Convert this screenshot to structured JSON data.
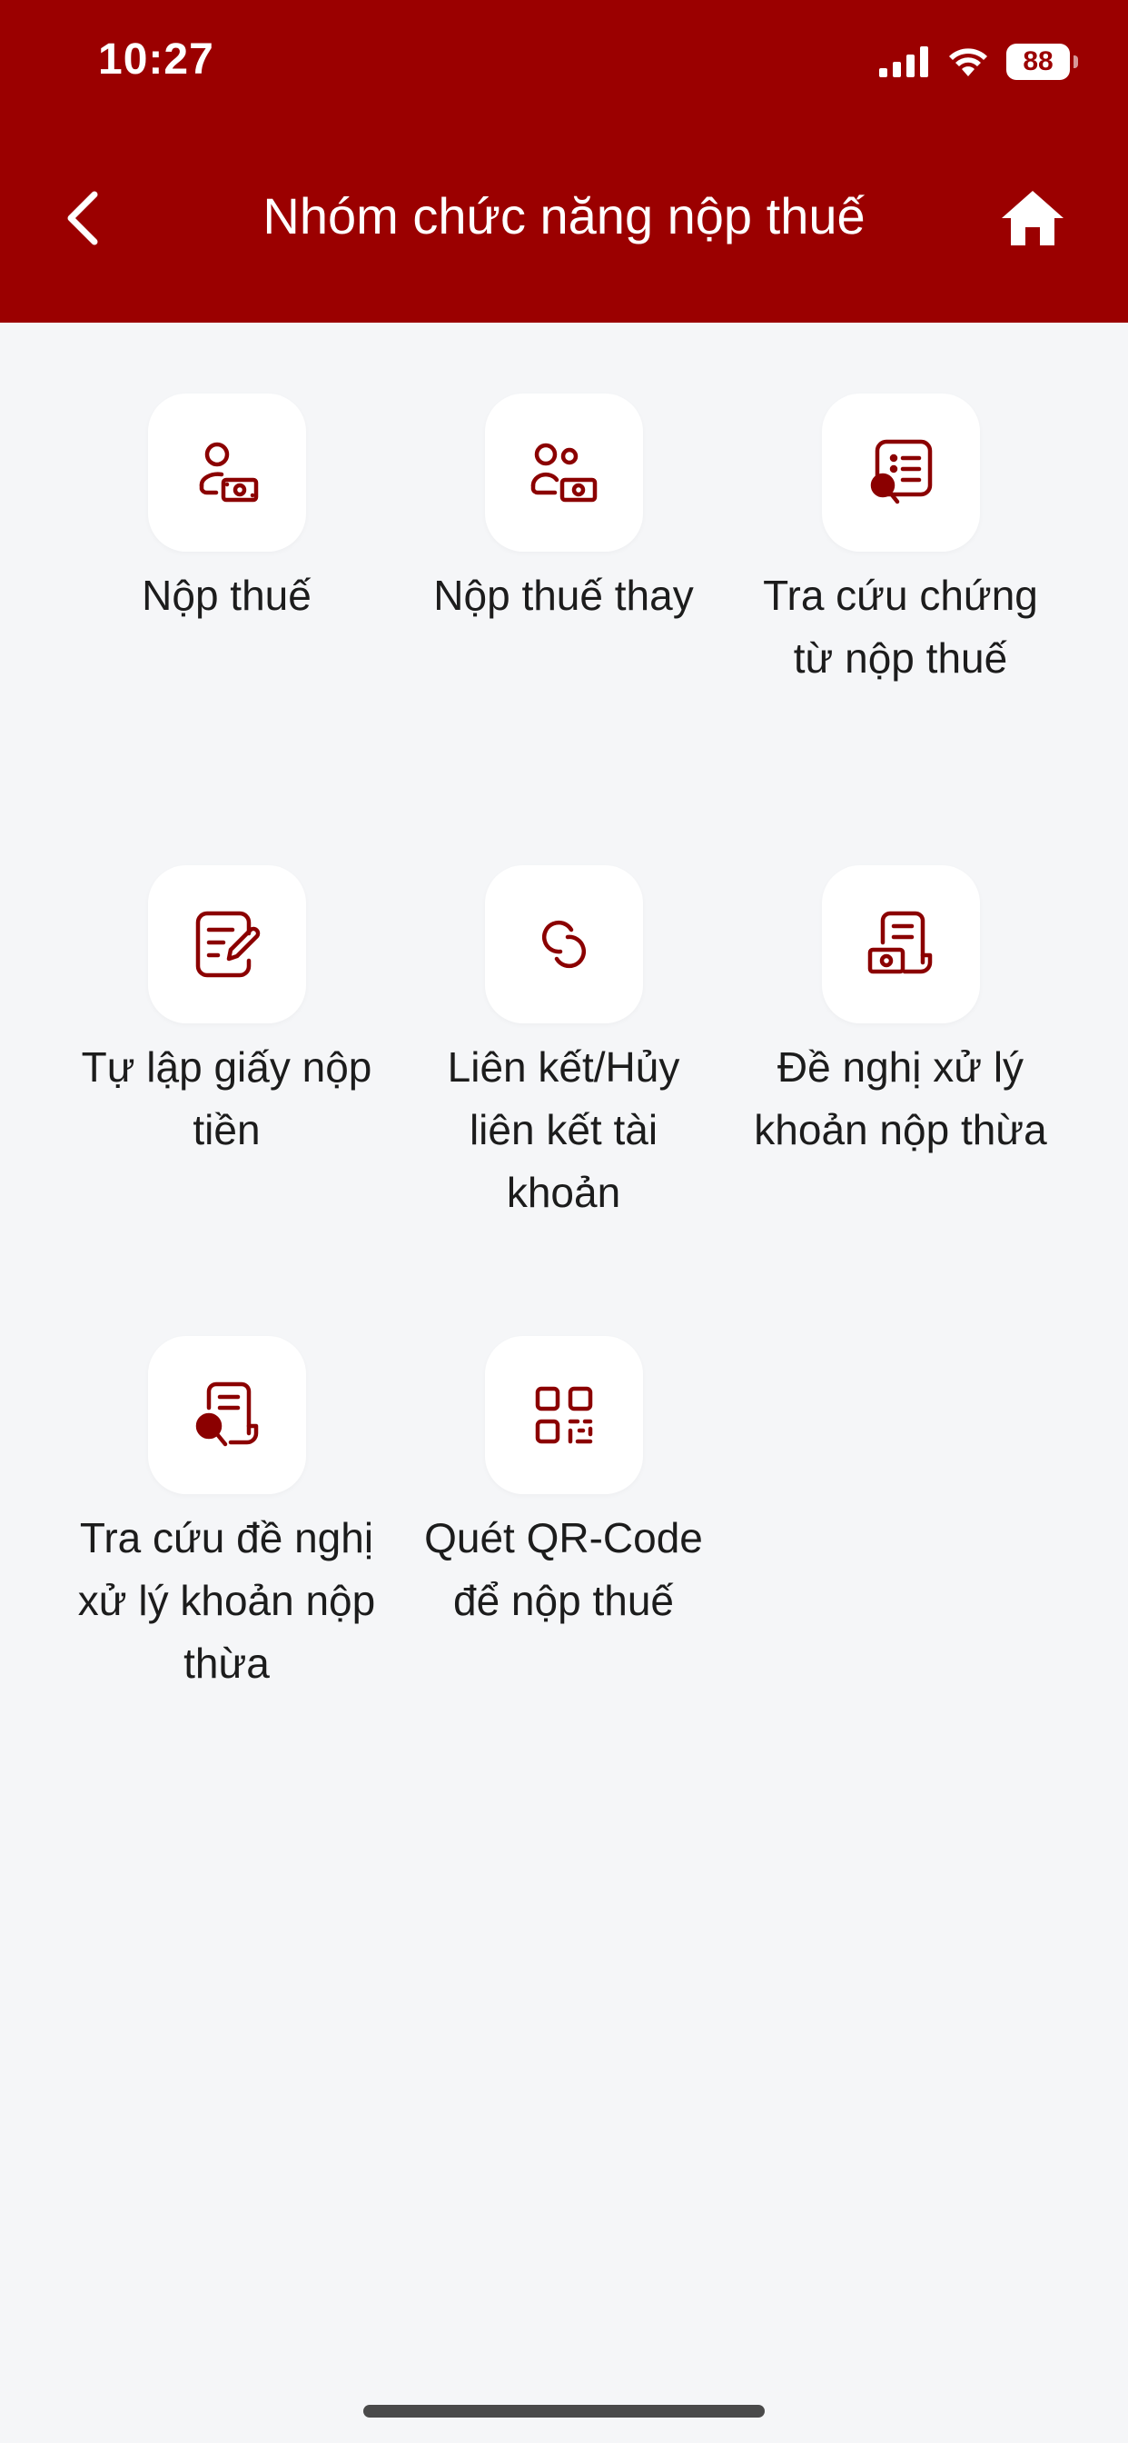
{
  "status_bar": {
    "time": "10:27",
    "battery": "88",
    "icons": [
      "signal-icon",
      "wifi-icon",
      "battery-icon"
    ]
  },
  "header": {
    "title": "Nhóm chức năng nộp thuế",
    "back_icon": "chevron-left-icon",
    "home_icon": "home-icon"
  },
  "theme": {
    "primary": "#9b0000",
    "background": "#f5f6f8",
    "tile_background": "#ffffff",
    "icon_color": "#8b0000"
  },
  "items": [
    {
      "label": "Nộp thuế",
      "icon": "person-money-icon"
    },
    {
      "label": "Nộp thuế thay",
      "icon": "group-money-icon"
    },
    {
      "label": "Tra cứu chứng từ nộp thuế",
      "icon": "document-search-icon"
    },
    {
      "label": "Tự lập giấy nộp tiền",
      "icon": "edit-document-icon"
    },
    {
      "label": "Liên kết/Hủy liên kết tài khoản",
      "icon": "link-icon"
    },
    {
      "label": "Đề nghị xử lý khoản nộp thừa",
      "icon": "receipt-money-icon"
    },
    {
      "label": "Tra cứu đề nghị xử lý khoản nộp thừa",
      "icon": "receipt-search-icon"
    },
    {
      "label": "Quét QR-Code để nộp thuế",
      "icon": "qr-code-icon"
    }
  ]
}
